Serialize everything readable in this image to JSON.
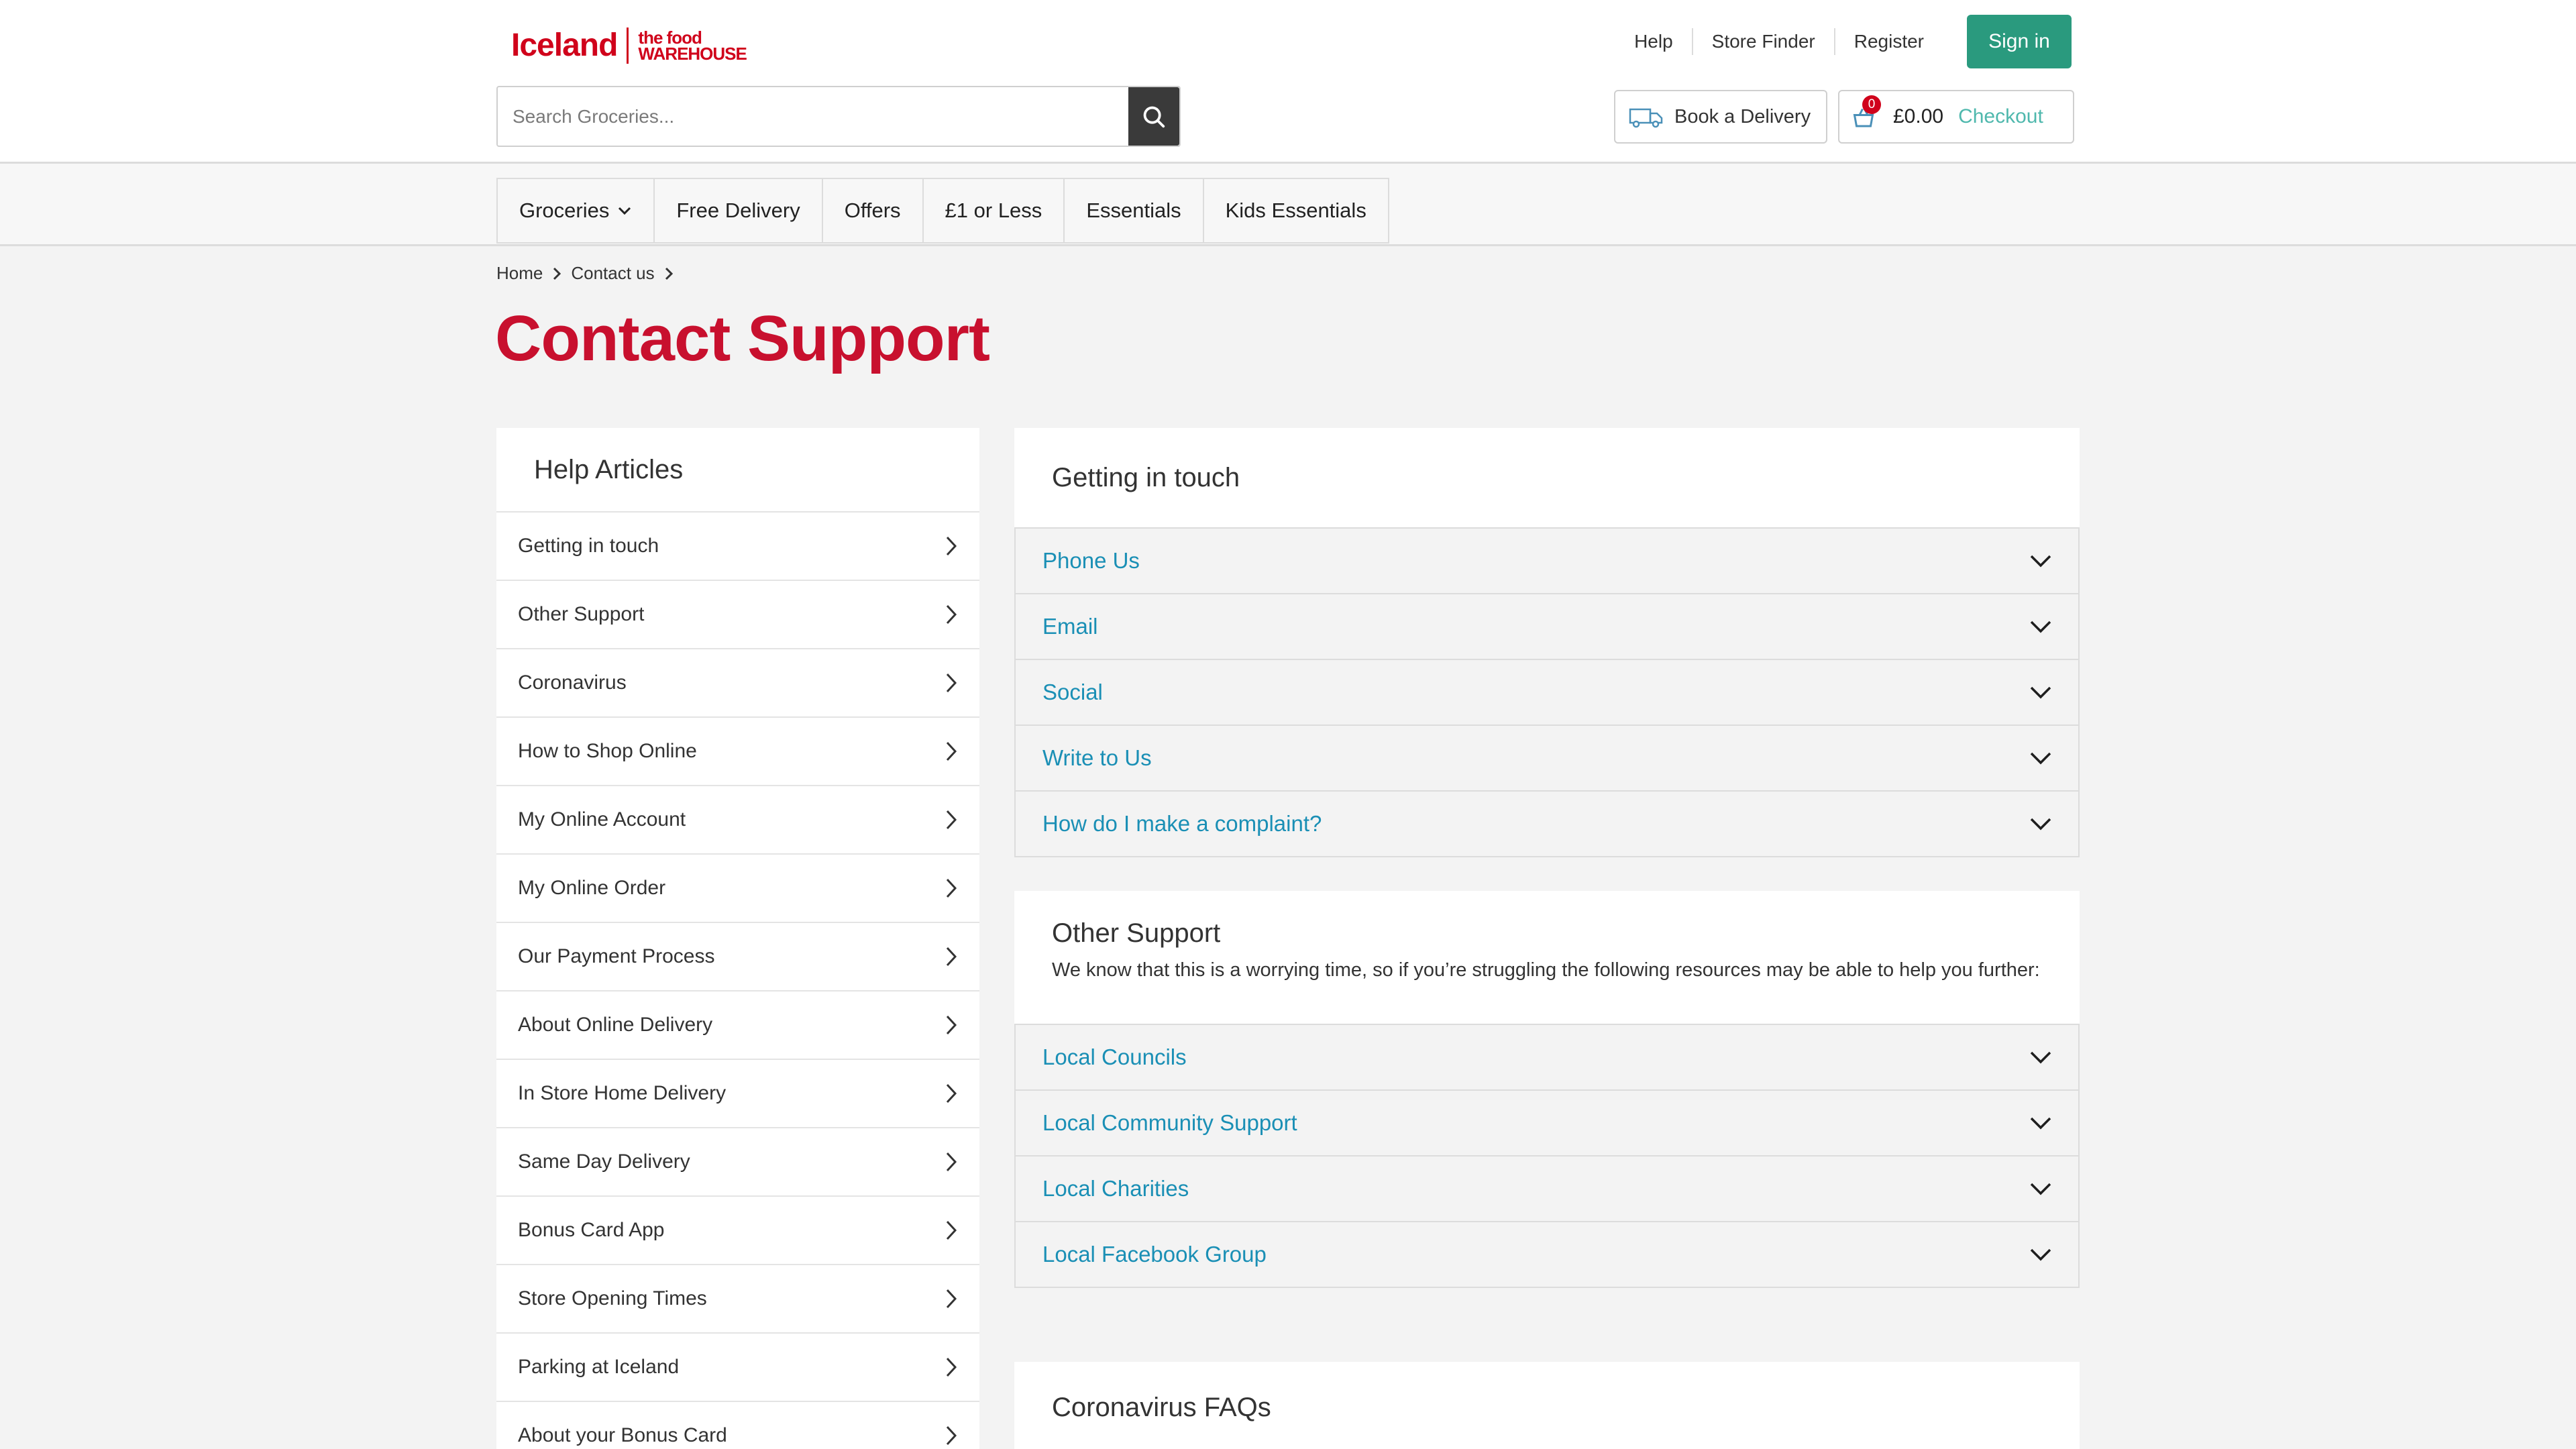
{
  "header": {
    "logo_main": "Iceland",
    "logo_sub_line1": "the food",
    "logo_sub_line2": "WAREHOUSE",
    "links": [
      "Help",
      "Store Finder",
      "Register"
    ],
    "sign_in": "Sign in",
    "search_placeholder": "Search Groceries...",
    "search_icon": "search-icon",
    "delivery_label": "Book a Delivery",
    "delivery_icon": "van-icon",
    "basket_count": "0",
    "basket_total": "£0.00",
    "checkout": "Checkout",
    "brand_color": "#d0021b",
    "accent_color": "#2a9a7e"
  },
  "nav": {
    "items": [
      "Groceries",
      "Free Delivery",
      "Offers",
      "£1 or Less",
      "Essentials",
      "Kids Essentials"
    ]
  },
  "breadcrumb": [
    "Home",
    "Contact us"
  ],
  "page_title": "Contact Support",
  "sidebar": {
    "title": "Help Articles",
    "items": [
      "Getting in touch",
      "Other Support",
      "Coronavirus",
      "How to Shop Online",
      "My Online Account",
      "My Online Order",
      "Our Payment Process",
      "About Online Delivery",
      "In Store Home Delivery",
      "Same Day Delivery",
      "Bonus Card App",
      "Store Opening Times",
      "Parking at Iceland",
      "About your Bonus Card"
    ]
  },
  "getting_in_touch": {
    "title": "Getting in touch",
    "items": [
      "Phone Us",
      "Email",
      "Social",
      "Write to Us",
      "How do I make a complaint?"
    ]
  },
  "other_support": {
    "title": "Other Support",
    "description": "We know that this is a worrying time, so if you’re struggling the following resources may be able to help you further:",
    "items": [
      "Local Councils",
      "Local Community Support",
      "Local Charities",
      "Local Facebook Group"
    ]
  },
  "coronavirus": {
    "title": "Coronavirus FAQs"
  },
  "link_color": "#1a8fb5"
}
